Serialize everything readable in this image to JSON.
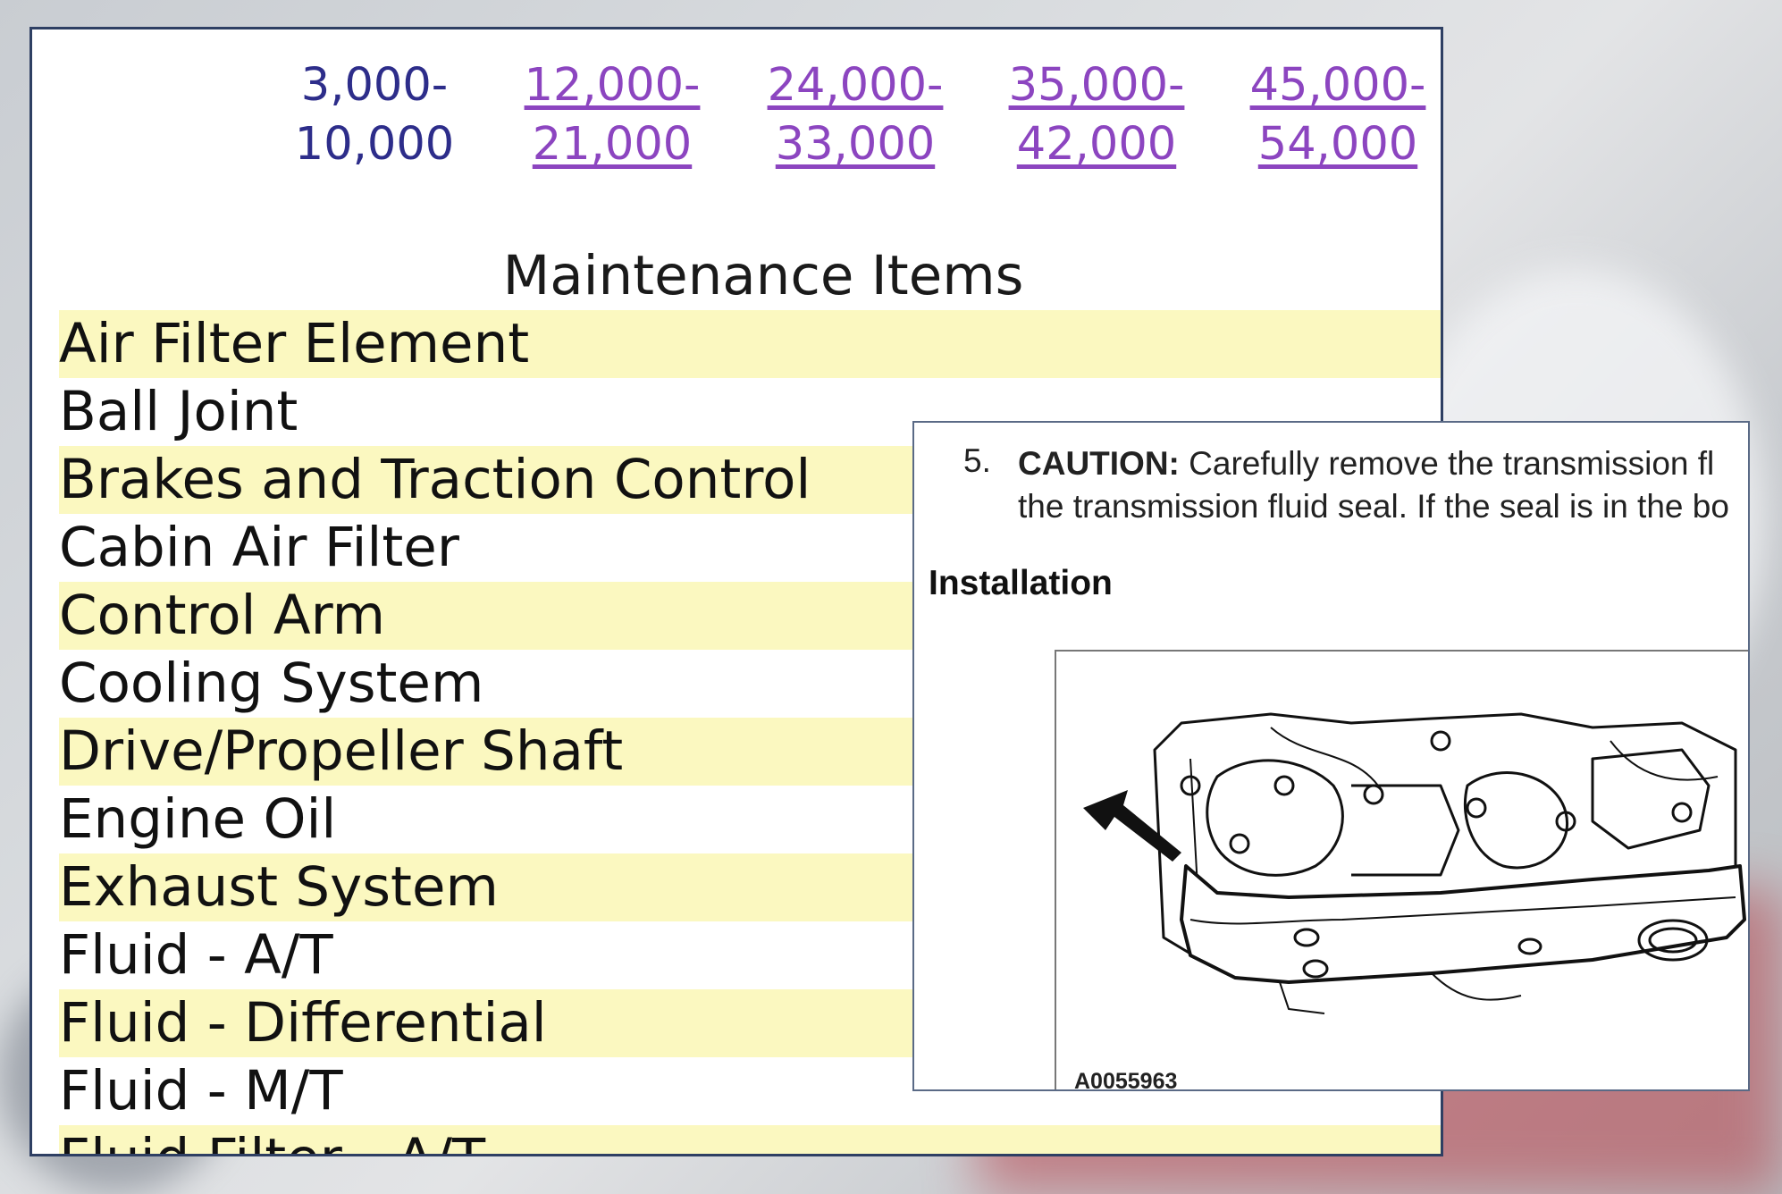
{
  "schedule": {
    "intervals": [
      {
        "line1": "3,000-",
        "line2": "10,000",
        "link": false
      },
      {
        "line1": "12,000-",
        "line2": "21,000",
        "link": true
      },
      {
        "line1": "24,000-",
        "line2": "33,000",
        "link": true
      },
      {
        "line1": "35,000-",
        "line2": "42,000",
        "link": true
      },
      {
        "line1": "45,000-",
        "line2": "54,000",
        "link": true
      }
    ],
    "heading": "Maintenance Items",
    "items": [
      "Air Filter Element",
      "Ball Joint",
      "Brakes and Traction Control",
      "Cabin Air Filter",
      "Control Arm",
      "Cooling System",
      "Drive/Propeller Shaft",
      "Engine Oil",
      "Exhaust System",
      "Fluid - A/T",
      "Fluid - Differential",
      "Fluid - M/T",
      "Fluid Filter - A/T"
    ],
    "row_colors": {
      "shaded": "#fbf8c0",
      "plain": "#ffffff"
    },
    "link_color": "#8c45c0",
    "text_color": "#2d2d8a"
  },
  "install_panel": {
    "step_number": "5.",
    "caution_label": "CAUTION:",
    "caution_line1": "Carefully remove the transmission fl",
    "caution_line2": "the transmission fluid seal. If the seal is in the bo",
    "section_title": "Installation",
    "figure_id": "A0055963",
    "figure_icon": "transmission-diagram-icon"
  }
}
